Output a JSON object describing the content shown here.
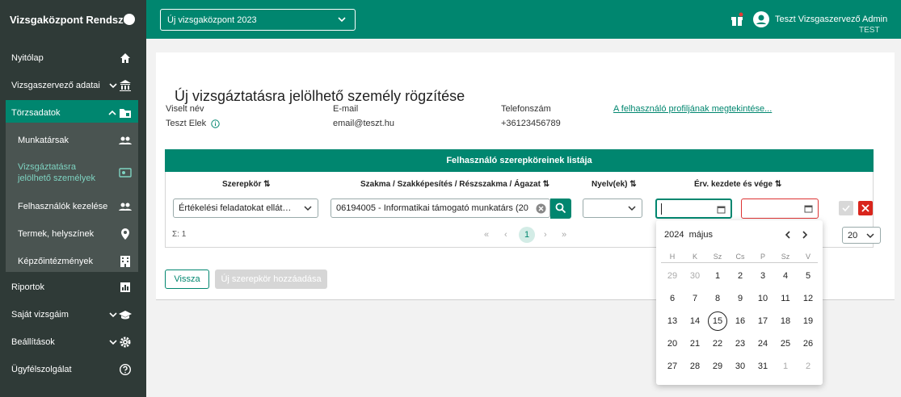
{
  "app": {
    "title": "Vizsgaközpont Rendszer",
    "center_select": "Új vizsgaközpont 2023",
    "user_name": "Teszt Vizsgaszervező Admin",
    "user_tag": "TEST"
  },
  "sidebar": {
    "items": [
      {
        "label": "Nyitólap",
        "icon": "home-icon"
      },
      {
        "label": "Vizsgaszervező adatai",
        "icon": "bank-icon"
      },
      {
        "label": "Törzsadatok",
        "icon": "folder-icon"
      },
      {
        "label": "Riportok",
        "icon": "report-icon"
      },
      {
        "label": "Saját vizsgáim",
        "icon": "graduation-icon"
      },
      {
        "label": "Beállítások",
        "icon": "gear-icon"
      },
      {
        "label": "Ügyfélszolgálat",
        "icon": "help-icon"
      }
    ],
    "sub": [
      {
        "label": "Munkatársak",
        "icon": "people-icon"
      },
      {
        "label": "Vizsgáztatásra jelölhető személyek",
        "icon": "person-card-icon"
      },
      {
        "label": "Felhasználók kezelése",
        "icon": "people-icon"
      },
      {
        "label": "Termek, helyszínek",
        "icon": "location-icon"
      },
      {
        "label": "Képzőintézmények",
        "icon": "building-icon"
      }
    ]
  },
  "page": {
    "title": "Új vizsgáztatásra jelölhető személy rögzítése",
    "labels": {
      "name": "Viselt név",
      "email": "E-mail",
      "phone": "Telefonszám"
    },
    "values": {
      "name": "Teszt Elek",
      "email": "email@teszt.hu",
      "phone": "+36123456789"
    },
    "profile_link": "A felhasználó profiljának megtekintése..."
  },
  "roles": {
    "header": "Felhasználó szerepköreinek listája",
    "columns": [
      "Szerepkör ⇅",
      "Szakma / Szakképesítés / Részszakma / Ágazat ⇅",
      "Nyelv(ek) ⇅",
      "Érv. kezdete és vége ⇅"
    ],
    "role_value": "Értékelési feladatokat ellát…",
    "profession_value": "06194005 - Informatikai támogató munkatárs (20",
    "language_value": "",
    "count": "Σ: 1",
    "page": "1",
    "page_size": "20",
    "pager": {
      "first": "«",
      "prev": "‹",
      "next": "›",
      "last": "»"
    }
  },
  "buttons": {
    "back": "Vissza",
    "add": "Új szerepkör hozzáadása"
  },
  "calendar": {
    "year": "2024",
    "month": "május",
    "weekdays": [
      "H",
      "K",
      "Sz",
      "Cs",
      "P",
      "Sz",
      "V"
    ],
    "weeks": [
      [
        "29",
        "30",
        "1",
        "2",
        "3",
        "4",
        "5"
      ],
      [
        "6",
        "7",
        "8",
        "9",
        "10",
        "11",
        "12"
      ],
      [
        "13",
        "14",
        "15",
        "16",
        "17",
        "18",
        "19"
      ],
      [
        "20",
        "21",
        "22",
        "23",
        "24",
        "25",
        "26"
      ],
      [
        "27",
        "28",
        "29",
        "30",
        "31",
        "1",
        "2"
      ]
    ],
    "selected": "15"
  },
  "colors": {
    "accent": "#00866f",
    "sidebar": "#2f3a37",
    "danger": "#d9251c"
  }
}
